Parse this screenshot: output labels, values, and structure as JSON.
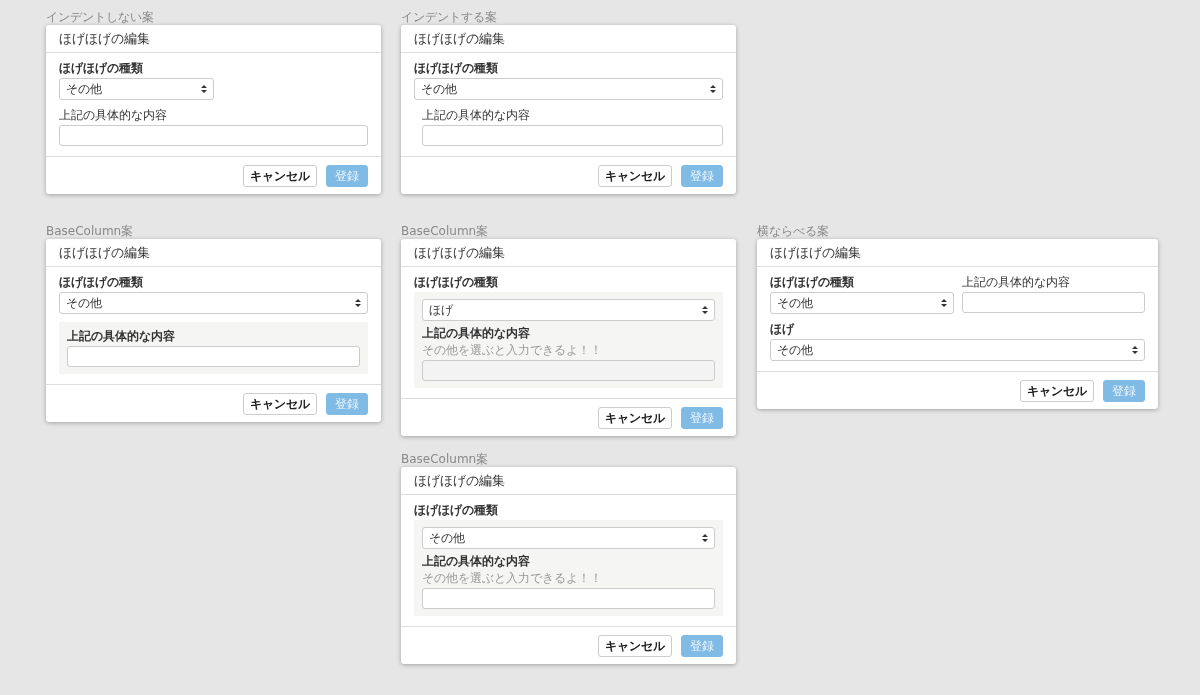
{
  "artboards": [
    {
      "label": "インデントしない案",
      "kind": "plain",
      "dialog": {
        "title": "ほげほげの編集",
        "fields": [
          {
            "kind": "select",
            "label": "ほげほげの種類",
            "bold": true,
            "value": "その他"
          },
          {
            "kind": "text",
            "label": "上記の具体的な内容",
            "bold": false,
            "disabled": false
          }
        ],
        "buttons": [
          {
            "kind": "secondary",
            "label": "キャンセル",
            "disabled": false
          },
          {
            "kind": "primary",
            "label": "登録",
            "disabled": true
          }
        ]
      }
    },
    {
      "label": "インデントする案",
      "kind": "indent",
      "dialog": {
        "title": "ほげほげの編集",
        "fields": [
          {
            "kind": "select",
            "label": "ほげほげの種類",
            "bold": true,
            "value": "その他"
          },
          {
            "kind": "text",
            "label": "上記の具体的な内容",
            "bold": false,
            "disabled": false
          }
        ],
        "buttons": [
          {
            "kind": "secondary",
            "label": "キャンセル",
            "disabled": false
          },
          {
            "kind": "primary",
            "label": "登録",
            "disabled": true
          }
        ]
      }
    },
    {
      "label": "BaseColumn案",
      "kind": "panel-rest",
      "dialog": {
        "title": "ほげほげの編集",
        "fields": [
          {
            "kind": "select",
            "label": "ほげほげの種類",
            "bold": true,
            "value": "その他"
          },
          {
            "kind": "text",
            "label": "上記の具体的な内容",
            "bold": true,
            "disabled": false
          }
        ],
        "buttons": [
          {
            "kind": "secondary",
            "label": "キャンセル",
            "disabled": false
          },
          {
            "kind": "primary",
            "label": "登録",
            "disabled": true
          }
        ]
      }
    },
    {
      "label": "BaseColumn案",
      "kind": "panel-all",
      "dialog": {
        "title": "ほげほげの編集",
        "fields": [
          {
            "kind": "select",
            "label": "ほげほげの種類",
            "bold": true,
            "value": "ほげ"
          },
          {
            "kind": "text",
            "label": "上記の具体的な内容",
            "bold": true,
            "hint": "その他を選ぶと入力できるよ！！",
            "disabled": true
          }
        ],
        "buttons": [
          {
            "kind": "secondary",
            "label": "キャンセル",
            "disabled": false
          },
          {
            "kind": "primary",
            "label": "登録",
            "disabled": true
          }
        ]
      }
    },
    {
      "label": "横ならべる案",
      "kind": "columns",
      "dialog": {
        "title": "ほげほげの編集",
        "fields": [
          {
            "kind": "select",
            "label": "ほげほげの種類",
            "bold": true,
            "value": "その他"
          },
          {
            "kind": "text",
            "label": "上記の具体的な内容",
            "bold": false,
            "disabled": false
          },
          {
            "kind": "select",
            "label": "ほげ",
            "bold": true,
            "value": "その他"
          }
        ],
        "buttons": [
          {
            "kind": "secondary",
            "label": "キャンセル",
            "disabled": false
          },
          {
            "kind": "primary",
            "label": "登録",
            "disabled": true
          }
        ]
      }
    },
    {
      "label": "BaseColumn案",
      "kind": "panel-all",
      "dialog": {
        "title": "ほげほげの編集",
        "fields": [
          {
            "kind": "select",
            "label": "ほげほげの種類",
            "bold": true,
            "value": "その他"
          },
          {
            "kind": "text",
            "label": "上記の具体的な内容",
            "bold": true,
            "hint": "その他を選ぶと入力できるよ！！",
            "disabled": false
          }
        ],
        "buttons": [
          {
            "kind": "secondary",
            "label": "キャンセル",
            "disabled": false
          },
          {
            "kind": "primary",
            "label": "登録",
            "disabled": true
          }
        ]
      }
    }
  ]
}
